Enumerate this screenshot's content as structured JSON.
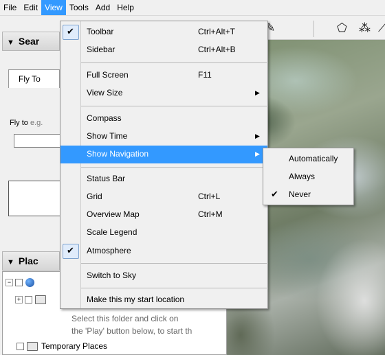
{
  "menubar": {
    "items": [
      "File",
      "Edit",
      "View",
      "Tools",
      "Add",
      "Help"
    ],
    "active_index": 2
  },
  "left_panel": {
    "search_title": "Sear",
    "tab_flyto": "Fly To",
    "fly_label": "Fly to",
    "fly_hint": "e.g.",
    "places_title": "Plac",
    "temporary_places": "Temporary Places",
    "hint_line1": "Select this folder and click on",
    "hint_line2": "the 'Play' button below, to start th"
  },
  "view_menu": {
    "items": {
      "toolbar": {
        "label": "Toolbar",
        "shortcut": "Ctrl+Alt+T",
        "checked": true
      },
      "sidebar": {
        "label": "Sidebar",
        "shortcut": "Ctrl+Alt+B"
      },
      "full_screen": {
        "label": "Full Screen",
        "shortcut": "F11"
      },
      "view_size": {
        "label": "View Size"
      },
      "compass": {
        "label": "Compass"
      },
      "show_time": {
        "label": "Show Time"
      },
      "show_navigation": {
        "label": "Show Navigation"
      },
      "status_bar": {
        "label": "Status Bar"
      },
      "grid": {
        "label": "Grid",
        "shortcut": "Ctrl+L"
      },
      "overview_map": {
        "label": "Overview Map",
        "shortcut": "Ctrl+M"
      },
      "scale_legend": {
        "label": "Scale Legend"
      },
      "atmosphere": {
        "label": "Atmosphere",
        "checked": true
      },
      "switch_to_sky": {
        "label": "Switch to Sky"
      },
      "start_location": {
        "label": "Make this my start location"
      }
    }
  },
  "navigation_submenu": {
    "items": [
      "Automatically",
      "Always",
      "Never"
    ],
    "checked": "Never"
  },
  "glyphs": {
    "check": "✔",
    "arrow": "▶",
    "tri_down": "▼",
    "plus": "+",
    "minus": "−"
  },
  "colors": {
    "highlight": "#3399ff",
    "menu_bg": "#f0f0f0"
  }
}
